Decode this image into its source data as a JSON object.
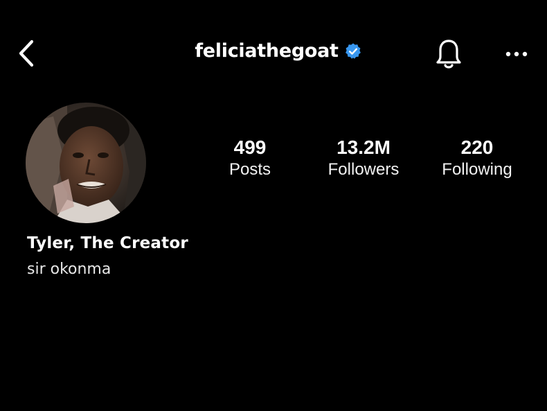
{
  "header": {
    "username": "feliciathegoat",
    "verified": true,
    "back_icon": "chevron-left-icon",
    "bell_icon": "bell-icon",
    "more_icon": "more-horizontal-icon"
  },
  "profile": {
    "display_name": "Tyler, The Creator",
    "bio": "sir okonma",
    "avatar": "profile-photo"
  },
  "stats": [
    {
      "value": "499",
      "label": "Posts"
    },
    {
      "value": "13.2M",
      "label": "Followers"
    },
    {
      "value": "220",
      "label": "Following"
    }
  ],
  "colors": {
    "background": "#000000",
    "text": "#ffffff",
    "verified_badge": "#3897f0"
  }
}
